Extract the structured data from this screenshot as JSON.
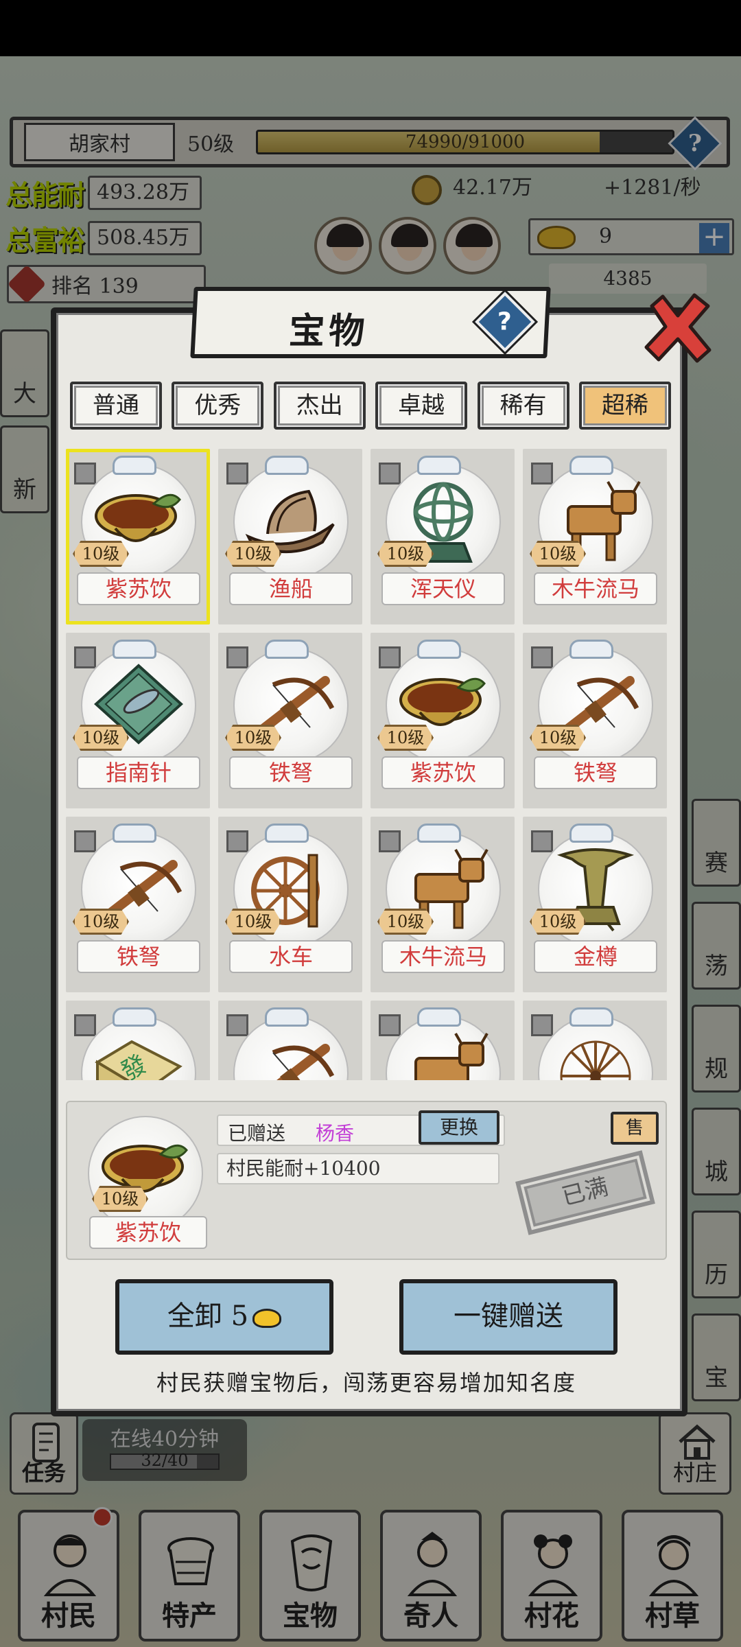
{
  "hud": {
    "village_name": "胡家村",
    "village_level": "50级",
    "exp_text": "74990/91000",
    "exp_fraction": 0.824,
    "help_icon": "question-icon",
    "ability_label": "总能耐",
    "ability_value": "493.28万",
    "wealth_label": "总富裕",
    "wealth_value": "508.45万",
    "coins_value": "42.17万",
    "coins_rate": "+1281/秒",
    "rank_text": "排名 139",
    "gold_count": "9",
    "plus_label": "+",
    "gem_count": "4385"
  },
  "modal": {
    "title": "宝物",
    "help_icon": "question-icon",
    "close_icon": "close-x-icon",
    "tabs": [
      {
        "label": "普通",
        "active": false
      },
      {
        "label": "优秀",
        "active": false
      },
      {
        "label": "杰出",
        "active": false
      },
      {
        "label": "卓越",
        "active": false
      },
      {
        "label": "稀有",
        "active": false
      },
      {
        "label": "超稀",
        "active": true
      }
    ],
    "items": [
      {
        "name": "紫苏饮",
        "level": "10级",
        "icon": "bowl-icon",
        "selected": true
      },
      {
        "name": "渔船",
        "level": "10级",
        "icon": "boat-icon",
        "selected": false
      },
      {
        "name": "浑天仪",
        "level": "10级",
        "icon": "armillary-sphere-icon",
        "selected": false
      },
      {
        "name": "木牛流马",
        "level": "10级",
        "icon": "wooden-ox-icon",
        "selected": false
      },
      {
        "name": "指南针",
        "level": "10级",
        "icon": "compass-icon",
        "selected": false
      },
      {
        "name": "铁弩",
        "level": "10级",
        "icon": "crossbow-icon",
        "selected": false
      },
      {
        "name": "紫苏饮",
        "level": "10级",
        "icon": "bowl-icon",
        "selected": false
      },
      {
        "name": "铁弩",
        "level": "10级",
        "icon": "crossbow-icon",
        "selected": false
      },
      {
        "name": "铁弩",
        "level": "10级",
        "icon": "crossbow-icon",
        "selected": false
      },
      {
        "name": "水车",
        "level": "10级",
        "icon": "waterwheel-icon",
        "selected": false
      },
      {
        "name": "木牛流马",
        "level": "10级",
        "icon": "wooden-ox-icon",
        "selected": false
      },
      {
        "name": "金樽",
        "level": "10级",
        "icon": "goblet-icon",
        "selected": false
      },
      {
        "name": "",
        "level": "",
        "icon": "mahjong-tile-icon",
        "tile_char": "發",
        "selected": false
      },
      {
        "name": "",
        "level": "",
        "icon": "crossbow-icon",
        "selected": false
      },
      {
        "name": "",
        "level": "",
        "icon": "wooden-ox-icon",
        "selected": false
      },
      {
        "name": "",
        "level": "",
        "icon": "spinning-wheel-icon",
        "selected": false
      }
    ],
    "detail": {
      "name": "紫苏饮",
      "level": "10级",
      "gifted_label": "已赠送",
      "gifted_to": "杨香",
      "change_label": "更换",
      "sell_label": "售",
      "bonus": "村民能耐+10400",
      "full_stamp": "已满"
    },
    "unload_all_label": "全卸 5",
    "gift_all_label": "一键赠送",
    "hint": "村民获赠宝物后，闯荡更容易增加知名度"
  },
  "side": {
    "left": [
      "大",
      "新"
    ],
    "right": [
      "赛",
      "荡",
      "规",
      "城",
      "历",
      "宝"
    ]
  },
  "task": {
    "label": "任务",
    "online_text": "在线40分钟",
    "progress_text": "32/40",
    "progress_fraction": 0.8
  },
  "village_button": "村庄",
  "nav": [
    {
      "label": "村民",
      "icon": "villager-icon"
    },
    {
      "label": "特产",
      "icon": "produce-basket-icon"
    },
    {
      "label": "宝物",
      "icon": "treasure-icon"
    },
    {
      "label": "奇人",
      "icon": "scholar-icon"
    },
    {
      "label": "村花",
      "icon": "village-belle-icon"
    },
    {
      "label": "村草",
      "icon": "village-hunk-icon"
    }
  ],
  "colors": {
    "item_name": "#d13c3c",
    "gifted_name": "#c23fd6",
    "active_tab": "#f0c27a",
    "button_blue": "#9fc1d6",
    "selected_border": "#ece21e"
  }
}
